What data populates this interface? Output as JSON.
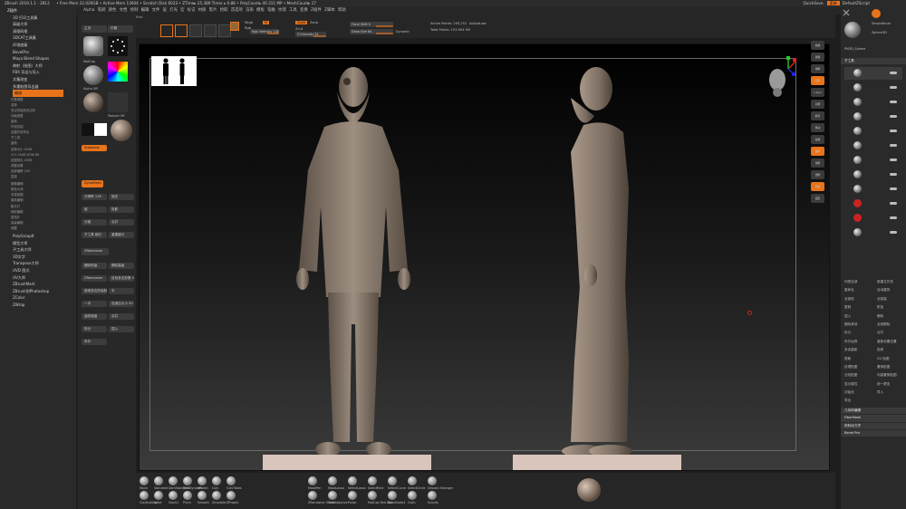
{
  "titlebar": {
    "app": "ZBrush 2019.1.1 - 2812",
    "mem": "• Free Mem 22.026GB • Active Mem 13604 • Scratch Disk 6033 • ZTime▸ 25.389 Timer ▸ 0.88 • PolyCount▸ 40.311 MP • MeshCount▸ 17",
    "quicksave": "QuickSave",
    "menus_label": "菜单",
    "default_script": "DefaultZScript"
  },
  "menubar": [
    "Alpha",
    "笔刷",
    "颜色",
    "文档",
    "绘制",
    "编辑",
    "文件",
    "层",
    "灯光",
    "宏",
    "标记",
    "材质",
    "影片",
    "拾取",
    "首选项",
    "渲染",
    "模板",
    "笔触",
    "纹理",
    "工具",
    "变换",
    "Z插件",
    "Z脚本",
    "帮助"
  ],
  "left_panel": {
    "header": "Z插件",
    "items": [
      {
        "label": "3D 打印工具集",
        "hl": false
      },
      {
        "label": "高级大师",
        "hl": false
      },
      {
        "label": "清理网格",
        "hl": false
      },
      {
        "label": "3DCAT工具集",
        "hl": false
      },
      {
        "label": "环境遮蔽",
        "hl": false
      },
      {
        "label": "BevelPro",
        "hl": false
      },
      {
        "label": "Maya Blend Shapes",
        "hl": false
      },
      {
        "label": "映射（绘图）大师",
        "hl": false
      },
      {
        "label": "FBX 导出与导入",
        "hl": false
      },
      {
        "label": "文集改变",
        "hl": false
      },
      {
        "label": "多重贴图导出器",
        "hl": false
      },
      {
        "label": "缩放",
        "hl": true
      }
    ],
    "subitems": [
      "位置调整",
      "选择",
      "多边形组到多边形",
      "动画遮罩",
      "旋转",
      "环绕控制",
      "创建外部导出",
      "子工具",
      "重新",
      "选择大小 4096",
      "512 2048 4096 8K",
      "贴图导出 4096",
      "调整设置",
      "选择偏移 100",
      "复制"
    ],
    "items2": [
      "图像编辑",
      "颜色大师",
      "多重贴图",
      "重新编辑",
      "聚光灯",
      "映射编辑",
      "重拓扑",
      "高级编辑",
      "调整"
    ],
    "items3": [
      "PolyGroupIt",
      "模型大师",
      "子工具大师",
      "3D文字",
      "Transpose大师",
      "UVD 图式",
      "UV大师",
      "ZBrushMark",
      "ZBrush到Photoshop",
      "ZColor",
      "ZWrap"
    ]
  },
  "tool_tray": {
    "tabs": [
      "主页",
      "灯箱"
    ],
    "material": "MatCap",
    "brush": "Alpha Off",
    "texture": "Texture Off",
    "standard": "Standard",
    "dynamesh": "DynaMesh",
    "zremesher": "ZRemesher",
    "widgets": [
      "分辨率 128",
      "抛光",
      "组",
      "投影",
      "分组",
      "合并",
      "子工具 细分",
      "重建细分",
      "删除低级",
      "删除高级",
      "ZRemesher",
      "目标多边形数 5",
      "使用多边形绘制",
      "半",
      "一半",
      "自适应大小 50",
      "曲线强度",
      "合并",
      "拆分",
      "插入",
      "布尔"
    ]
  },
  "toolbar": {
    "edit": "Edit",
    "draw": "Draw",
    "move": "Move",
    "scale": "Scale",
    "rotate": "Rotate",
    "mrgb": "Mrgb",
    "rgb": "Rgb",
    "m": "M",
    "zadd": "Zadd",
    "zsub": "Zsub",
    "zcut": "Zcut",
    "focal": "Focal Shift 0",
    "draw_size": "Draw Size 64",
    "dynamic": "Dynamic",
    "z_intensity": "Z Intensity 25",
    "rgb_intensity": "Rgb Intensity 100",
    "active_points": "Active Points: 205,251",
    "total_points": "Total Points: 151.654 Mil",
    "adjust_last": "AdjustLast",
    "rest": "Rest"
  },
  "bottom": {
    "brushes": [
      "Move",
      "Standard",
      "DamStandard",
      "TrimDynamic",
      "hPolish",
      "Clay",
      "ClayTubes",
      "ClayBuildup",
      "Inflat",
      "Slash3",
      "Pinch",
      "Smooth",
      "Zmodeler",
      "ZProject",
      "MaskPen",
      "MaskLasso",
      "SelectLasso",
      "SelectRect",
      "SelectCurve",
      "SelectCircle",
      "Smooth Stronger",
      "ZRemesher Guide",
      "TrimAdaptive",
      "Polish",
      "MatCap Red Wax",
      "SkinShade4",
      "Cloth",
      "Gravity"
    ],
    "dyn_label": "Dynamic",
    "sculpt_label": "Sculpt",
    "mask_label": "Mask",
    "select_label": "Select"
  },
  "right_panel": {
    "header": "工具",
    "subtool_label": "子工具",
    "tools": [
      "SimpleBrush",
      "Sphere3D",
      "CylinderD",
      "PM3D_Sphere"
    ],
    "items": [
      "列表全部",
      "新建文件夹",
      "重命名",
      "自动重排",
      "全部低",
      "全部高",
      "复制",
      "附加",
      "插入",
      "删除",
      "删除其他",
      "全部删除",
      "拆分",
      "合并",
      "布尔运算",
      "重新设置位置",
      "多余重新",
      "投射",
      "提取",
      "UV 贴图",
      "纹理贴图",
      "置换贴图",
      "法线贴图",
      "向量置换贴图",
      "显示属性",
      "统一蒙皮",
      "初始化",
      "导入",
      "导出"
    ],
    "panels": [
      "几何体编辑",
      "FiberMesh",
      "布料动力学",
      "Bevel Pro"
    ]
  },
  "shelf": [
    "缩放",
    "透视",
    "地网",
    "局部",
    "L.Sym",
    "对称",
    "框架",
    "移动",
    "缩放",
    "旋转",
    "线框",
    "透明",
    "实体",
    "固定"
  ],
  "colors": {
    "accent": "#e8731a",
    "panel": "#2a2a2a",
    "viewport_bottom": "#3b3b3b",
    "model": "#8c7d70",
    "base": "#d9c5bc"
  },
  "icons": [
    "close-icon",
    "gear-icon",
    "search-icon",
    "palette-icon",
    "sphere-icon",
    "pawn-icon",
    "chevron-down-icon",
    "lock-icon",
    "eye-icon",
    "axis-gizmo-icon"
  ]
}
